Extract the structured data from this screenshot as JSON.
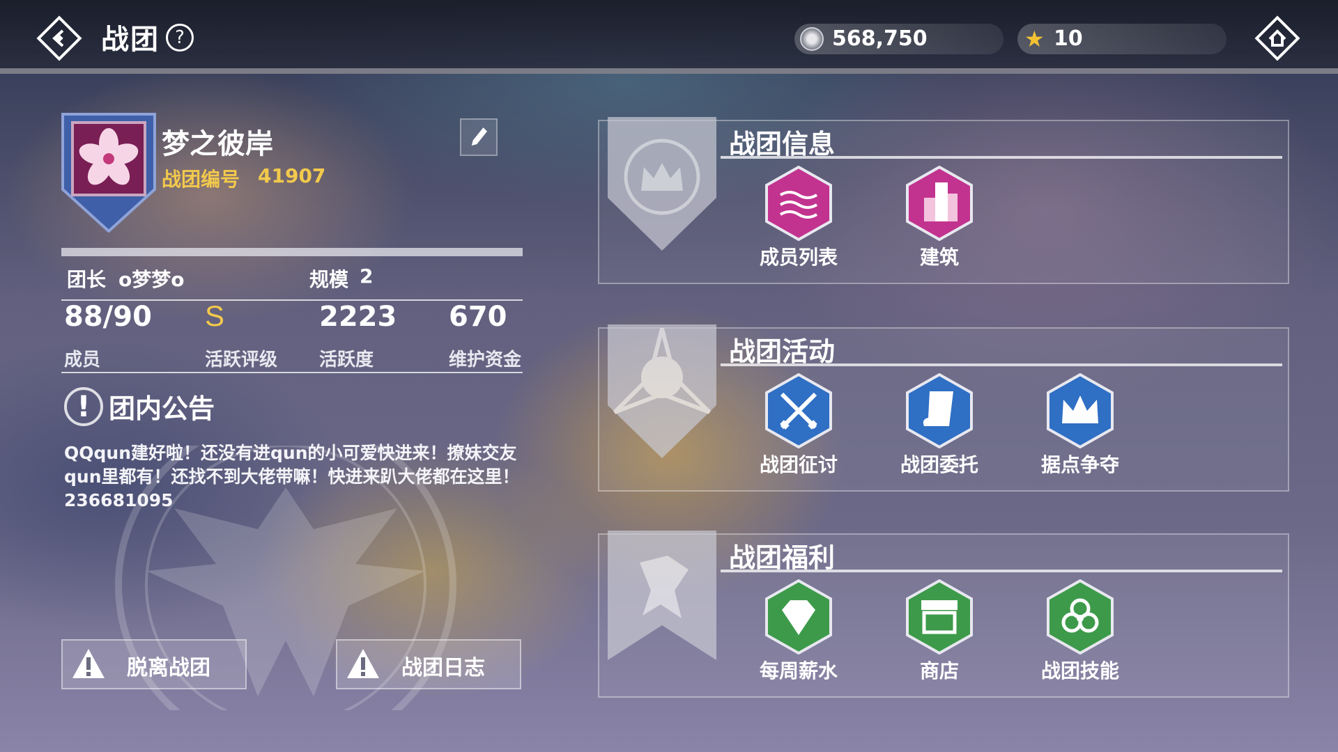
{
  "header": {
    "title": "战团",
    "currency": [
      {
        "icon": "silver-coin-icon",
        "value": "568,750"
      },
      {
        "icon": "gold-star-icon",
        "value": "10"
      }
    ]
  },
  "guild": {
    "name": "梦之彼岸",
    "id_label": "战团编号",
    "id": "41907",
    "leader_label": "团长",
    "leader_name": "o梦梦o",
    "scale_label": "规模",
    "scale_value": "2",
    "stats": [
      {
        "value": "88/90",
        "label": "成员"
      },
      {
        "value": "S",
        "label": "活跃评级"
      },
      {
        "value": "2223",
        "label": "活跃度"
      },
      {
        "value": "670",
        "label": "维护资金"
      }
    ],
    "notice_title": "团内公告",
    "notice_text": "QQqun建好啦！还没有进qun的小可爱快进来！撩妹交友qun里都有！还找不到大佬带嘛！快进来趴大佬都在这里！236681095"
  },
  "buttons": {
    "leave": "脱离战团",
    "log": "战团日志"
  },
  "sections": [
    {
      "title": "战团信息",
      "items": [
        {
          "label": "成员列表",
          "icon": "member-list-icon",
          "color": "#c2338f"
        },
        {
          "label": "建筑",
          "icon": "building-icon",
          "color": "#c2338f"
        }
      ]
    },
    {
      "title": "战团活动",
      "items": [
        {
          "label": "战团征讨",
          "icon": "crossed-swords-icon",
          "color": "#2f6fc4"
        },
        {
          "label": "战团委托",
          "icon": "scroll-icon",
          "color": "#2f6fc4"
        },
        {
          "label": "据点争夺",
          "icon": "crown-icon",
          "color": "#2f6fc4"
        }
      ]
    },
    {
      "title": "战团福利",
      "items": [
        {
          "label": "每周薪水",
          "icon": "diamond-icon",
          "color": "#3d9a4a"
        },
        {
          "label": "商店",
          "icon": "shop-icon",
          "color": "#3d9a4a"
        },
        {
          "label": "战团技能",
          "icon": "biohazard-icon",
          "color": "#3d9a4a"
        }
      ]
    }
  ]
}
